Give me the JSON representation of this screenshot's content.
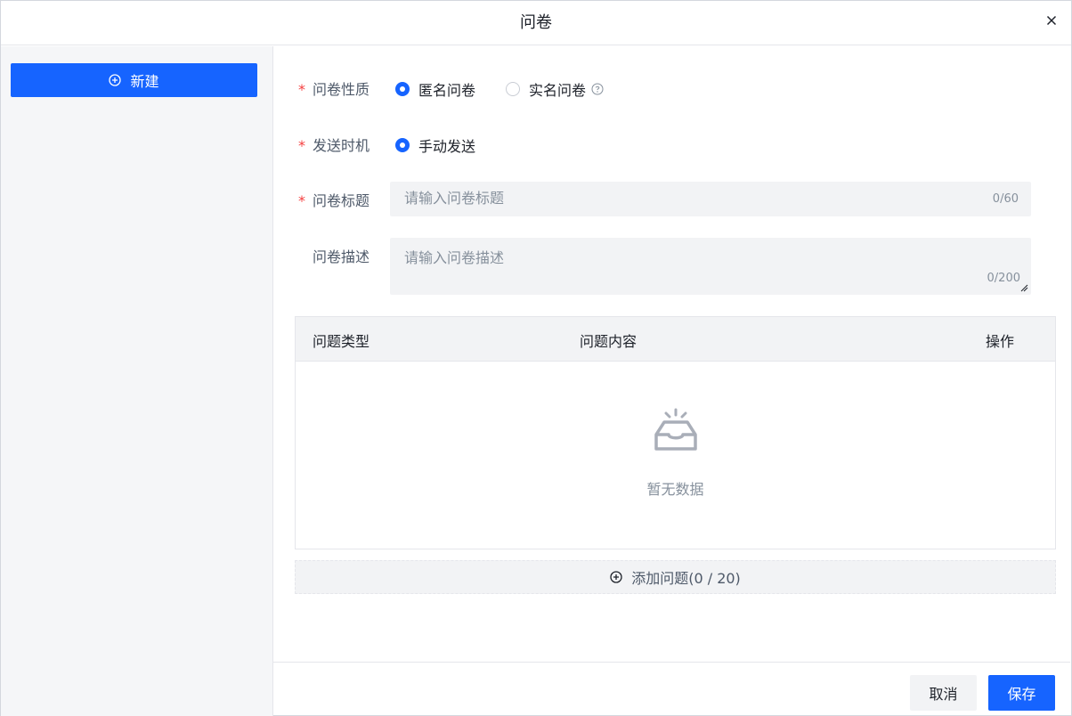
{
  "dialog": {
    "title": "问卷"
  },
  "sidebar": {
    "new_label": "新建"
  },
  "form": {
    "nature": {
      "label": "问卷性质",
      "options": [
        {
          "label": "匿名问卷",
          "selected": true
        },
        {
          "label": "实名问卷",
          "selected": false
        }
      ]
    },
    "timing": {
      "label": "发送时机",
      "options": [
        {
          "label": "手动发送",
          "selected": true
        }
      ]
    },
    "title_field": {
      "label": "问卷标题",
      "placeholder": "请输入问卷标题",
      "value": "",
      "counter": "0/60"
    },
    "desc_field": {
      "label": "问卷描述",
      "placeholder": "请输入问卷描述",
      "value": "",
      "counter": "0/200"
    },
    "required_mark": "*"
  },
  "table": {
    "columns": [
      "问题类型",
      "问题内容",
      "操作"
    ],
    "rows": [],
    "empty_text": "暂无数据"
  },
  "add_question_label": "添加问题(0 / 20)",
  "footer": {
    "cancel_label": "取消",
    "save_label": "保存"
  },
  "colors": {
    "primary": "#1664ff",
    "required": "#f53f3f"
  }
}
